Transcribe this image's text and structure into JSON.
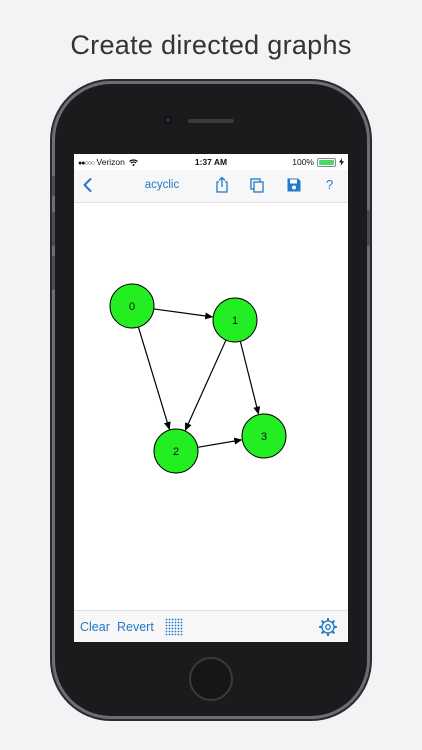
{
  "headline": "Create directed graphs",
  "status_bar": {
    "signal_dots": "●●○○○",
    "carrier": "Verizon",
    "time": "1:37 AM",
    "battery_percent": "100%"
  },
  "nav_bar": {
    "title": "acyclic",
    "back_icon": "chevron-left-icon",
    "share_icon": "share-icon",
    "duplicate_icon": "duplicate-icon",
    "save_icon": "save-icon",
    "help_label": "?"
  },
  "graph": {
    "node_color": "#22ee22",
    "nodes": [
      {
        "id": "0",
        "label": "0"
      },
      {
        "id": "1",
        "label": "1"
      },
      {
        "id": "2",
        "label": "2"
      },
      {
        "id": "3",
        "label": "3"
      }
    ],
    "edges": [
      {
        "from": "0",
        "to": "1"
      },
      {
        "from": "0",
        "to": "2"
      },
      {
        "from": "1",
        "to": "2"
      },
      {
        "from": "1",
        "to": "3"
      },
      {
        "from": "2",
        "to": "3"
      }
    ]
  },
  "toolbar": {
    "clear_label": "Clear",
    "revert_label": "Revert",
    "grid_icon": "grid-icon",
    "settings_icon": "gear-icon"
  },
  "colors": {
    "accent": "#2279c7",
    "node_fill": "#22ee22",
    "edge": "#000000"
  }
}
